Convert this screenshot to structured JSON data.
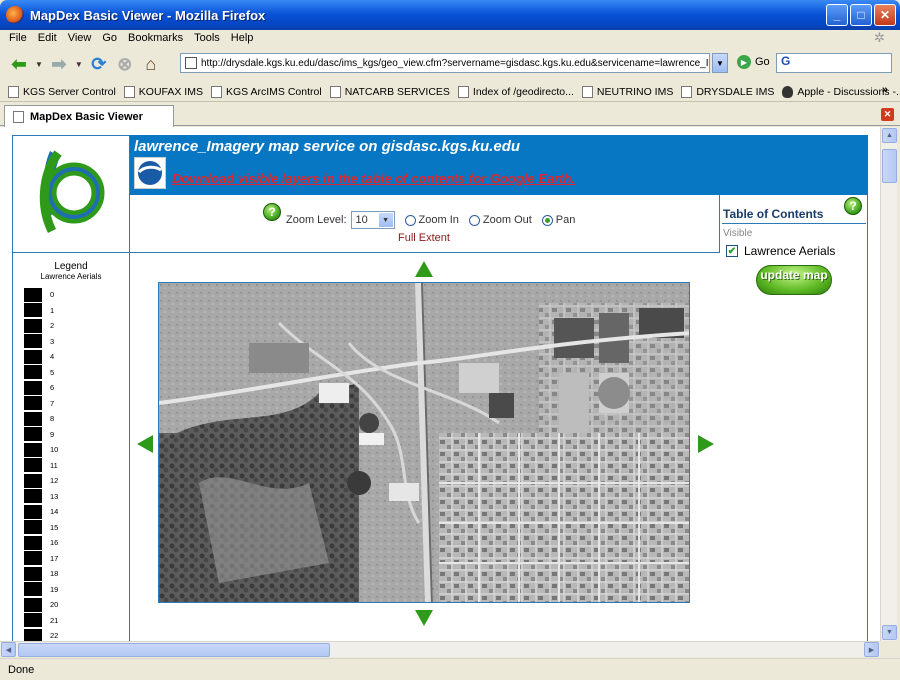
{
  "window": {
    "title": "MapDex Basic Viewer - Mozilla Firefox",
    "min": "_",
    "max": "□",
    "close": "✕"
  },
  "menu": [
    "File",
    "Edit",
    "View",
    "Go",
    "Bookmarks",
    "Tools",
    "Help"
  ],
  "nav": {
    "url": "http://drysdale.kgs.ku.edu/dasc/ims_kgs/geo_view.cfm?servername=gisdasc.kgs.ku.edu&servicename=lawrence_I",
    "go_label": "Go",
    "search_value": "G"
  },
  "bookmarks": [
    "KGS Server Control",
    "KOUFAX IMS",
    "KGS ArcIMS Control",
    "NATCARB SERVICES",
    "Index of /geodirecto...",
    "NEUTRINO IMS",
    "DRYSDALE IMS",
    "Apple - Discussions -..."
  ],
  "bookmarks_overflow": "»",
  "tab": {
    "title": "MapDex Basic Viewer"
  },
  "page": {
    "header_title": "lawrence_Imagery map service on gisdasc.kgs.ku.edu",
    "ge_link": "Download visible layers in the table of contents for Google Earth.",
    "help_glyph": "?",
    "zoom_label": "Zoom Level:",
    "zoom_value": "10",
    "zoom_in_label": "Zoom In",
    "zoom_out_label": "Zoom Out",
    "pan_label": "Pan",
    "selected_mode": "Pan",
    "full_extent": "Full Extent",
    "toc_title": "Table of Contents",
    "toc_visible_label": "Visible",
    "toc_layer": "Lawrence Aerials",
    "toc_layer_checked": true,
    "update_btn": "update map",
    "legend_title": "Legend",
    "legend_subtitle": "Lawrence Aerials",
    "legend_items": [
      "0",
      "1",
      "2",
      "3",
      "4",
      "5",
      "6",
      "7",
      "8",
      "9",
      "10",
      "11",
      "12",
      "13",
      "14",
      "15",
      "16",
      "17",
      "18",
      "19",
      "20",
      "21",
      "22"
    ]
  },
  "status": "Done",
  "colors": {
    "header_bg": "#0877c3",
    "link_red": "#e0262a",
    "border_blue": "#2d7ab8",
    "arrow_green": "#2f9a1a",
    "full_extent": "#8b1a1a"
  }
}
